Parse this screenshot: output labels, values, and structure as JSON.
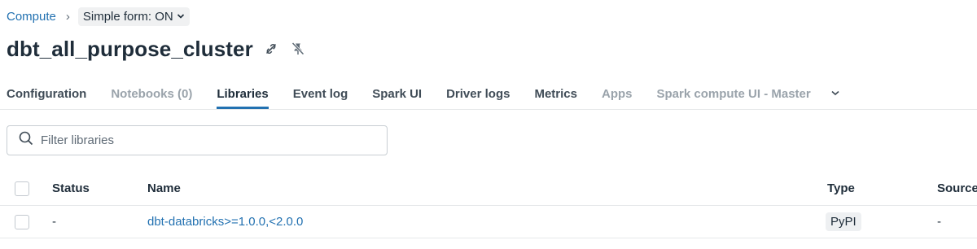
{
  "breadcrumb": {
    "parent": "Compute",
    "separator": "›",
    "form_toggle": "Simple form: ON"
  },
  "page": {
    "title": "dbt_all_purpose_cluster"
  },
  "tabs": [
    {
      "label": "Configuration",
      "state": "normal"
    },
    {
      "label": "Notebooks (0)",
      "state": "muted"
    },
    {
      "label": "Libraries",
      "state": "active"
    },
    {
      "label": "Event log",
      "state": "normal"
    },
    {
      "label": "Spark UI",
      "state": "normal"
    },
    {
      "label": "Driver logs",
      "state": "normal"
    },
    {
      "label": "Metrics",
      "state": "normal"
    },
    {
      "label": "Apps",
      "state": "muted"
    },
    {
      "label": "Spark compute UI - Master",
      "state": "muted"
    }
  ],
  "filter": {
    "placeholder": "Filter libraries",
    "value": ""
  },
  "table": {
    "headers": {
      "status": "Status",
      "name": "Name",
      "type": "Type",
      "source": "Source"
    },
    "rows": [
      {
        "status": "-",
        "name": "dbt-databricks>=1.0.0,<2.0.0",
        "type": "PyPI",
        "source": "-"
      }
    ]
  },
  "colors": {
    "accent": "#2271b1",
    "text": "#1f2d3a",
    "muted": "#9aa3ab",
    "border": "#e6e8ea"
  },
  "icons": {
    "form_toggle": "chevron-down-icon",
    "title_action_1": "unlink-icon",
    "title_action_2": "pin-off-icon",
    "tabs_more": "chevron-down-icon",
    "filter": "search-icon"
  }
}
